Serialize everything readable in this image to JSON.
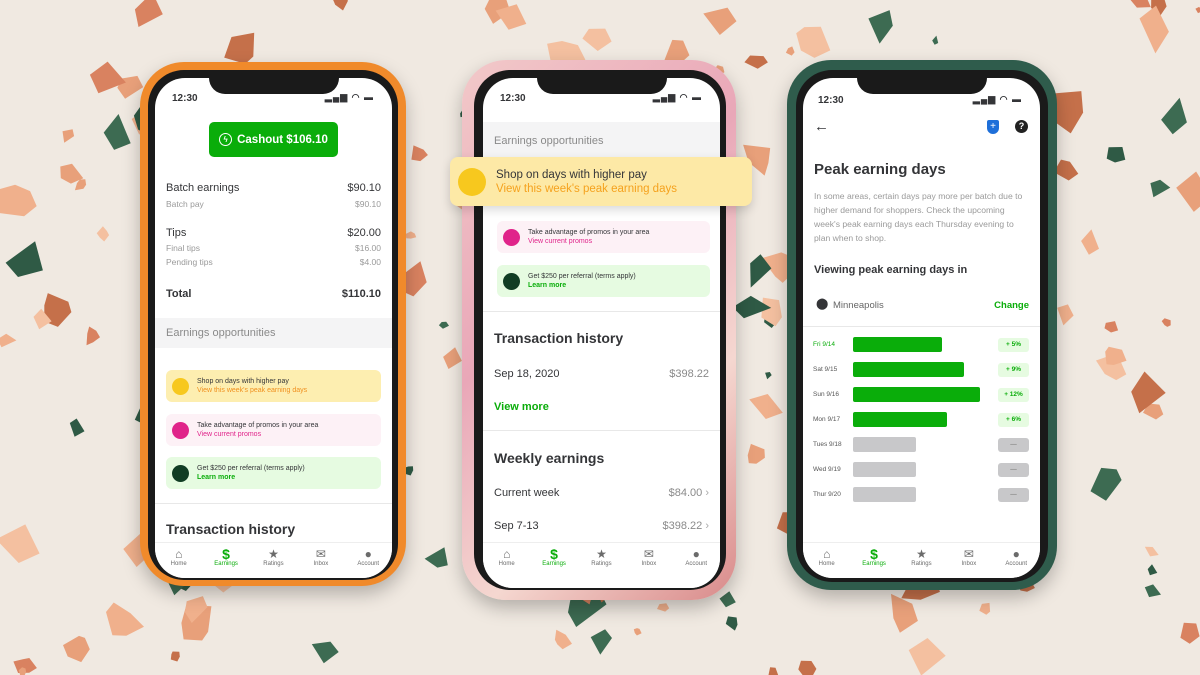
{
  "status_bar": {
    "time": "12:30",
    "icons": [
      "signal-icon",
      "wifi-icon",
      "battery-icon"
    ]
  },
  "colors": {
    "brand_green": "#0aad0a",
    "orange_case": "#f08a2b",
    "pink_case": "#e9b7c0",
    "green_case": "#2f5c4c",
    "promo_yellow": "#fdeeb0",
    "promo_pink": "#fdf1f6",
    "promo_green": "#e6fbe1"
  },
  "nav": [
    {
      "label": "Home",
      "icon": "home-icon"
    },
    {
      "label": "Earnings",
      "icon": "dollar-icon",
      "active": true
    },
    {
      "label": "Ratings",
      "icon": "star-icon"
    },
    {
      "label": "Inbox",
      "icon": "mail-icon"
    },
    {
      "label": "Account",
      "icon": "account-icon"
    }
  ],
  "promos": [
    {
      "title": "Shop on days with higher pay",
      "link": "View this week's peak earning days",
      "icon": "smiley-coin-icon"
    },
    {
      "title": "Take advantage of promos in your area",
      "link": "View current promos",
      "icon": "money-bag-icon"
    },
    {
      "title": "Get $250 per referral (terms apply)",
      "link": "Learn more",
      "icon": "referral-icon"
    }
  ],
  "phone1": {
    "cashout": "Cashout $106.10",
    "batch_earnings": {
      "label": "Batch earnings",
      "value": "$90.10"
    },
    "batch_pay": {
      "label": "Batch pay",
      "value": "$90.10"
    },
    "tips": {
      "label": "Tips",
      "value": "$20.00"
    },
    "final_tips": {
      "label": "Final tips",
      "value": "$16.00"
    },
    "pending_tips": {
      "label": "Pending tips",
      "value": "$4.00"
    },
    "total": {
      "label": "Total",
      "value": "$110.10"
    },
    "opportunities": "Earnings opportunities",
    "transaction_history": "Transaction history"
  },
  "phone2": {
    "opportunities": "Earnings opportunities",
    "transaction_history": "Transaction history",
    "transaction": {
      "date": "Sep 18, 2020",
      "amount": "$398.22"
    },
    "view_more": "View more",
    "weekly_earnings": "Weekly earnings",
    "weeks": [
      {
        "label": "Current week",
        "amount": "$84.00"
      },
      {
        "label": "Sep 7-13",
        "amount": "$398.22"
      }
    ]
  },
  "phone3": {
    "title": "Peak earning days",
    "description": "In some areas, certain days pay more per batch due to higher demand for shoppers. Check the upcoming week's peak earning days each Thursday evening to plan when to shop.",
    "viewing_label": "Viewing peak earning days in",
    "location": "Minneapolis",
    "change": "Change",
    "days": [
      {
        "label": "Fri 9/14",
        "percent": 5,
        "badge": "+ 5%",
        "highlight": true
      },
      {
        "label": "Sat 9/15",
        "percent": 9,
        "badge": "+ 9%"
      },
      {
        "label": "Sun 9/16",
        "percent": 12,
        "badge": "+ 12%"
      },
      {
        "label": "Mon 9/17",
        "percent": 6,
        "badge": "+ 6%"
      },
      {
        "label": "Tues 9/18",
        "percent": null,
        "badge": "—"
      },
      {
        "label": "Wed 9/19",
        "percent": null,
        "badge": "—"
      },
      {
        "label": "Thur 9/20",
        "percent": null,
        "badge": "—"
      }
    ]
  }
}
